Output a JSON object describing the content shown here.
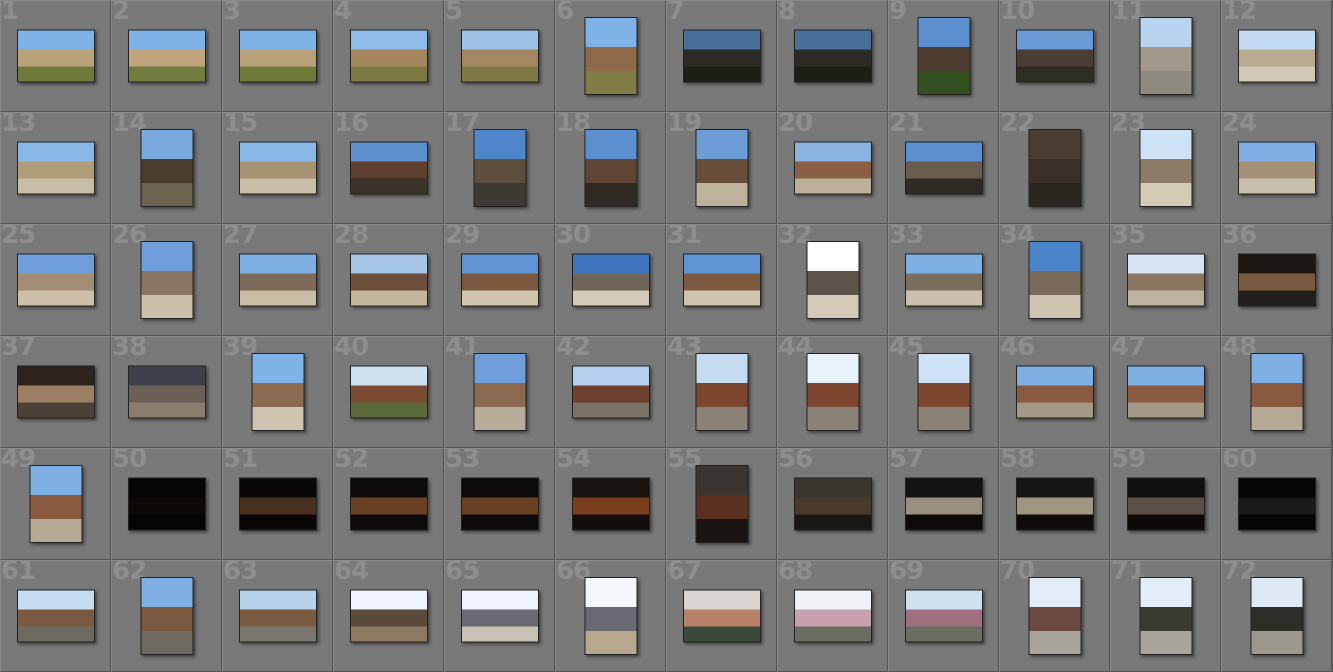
{
  "title": "",
  "grid": {
    "columns": 12,
    "rows": 6
  },
  "photos": [
    {
      "index": "1",
      "orientation": "landscape",
      "sky": "#7fb2e6",
      "mid": "#b9a27a",
      "ground": "#6e7a3a"
    },
    {
      "index": "2",
      "orientation": "landscape",
      "sky": "#7fb2e6",
      "mid": "#c0a57c",
      "ground": "#727c3e"
    },
    {
      "index": "3",
      "orientation": "landscape",
      "sky": "#7fb2e6",
      "mid": "#b9a27a",
      "ground": "#6e7a3a"
    },
    {
      "index": "4",
      "orientation": "landscape",
      "sky": "#8fbbe8",
      "mid": "#a4865c",
      "ground": "#7c7a44"
    },
    {
      "index": "5",
      "orientation": "landscape",
      "sky": "#9fc1e6",
      "mid": "#a38761",
      "ground": "#7f7a45"
    },
    {
      "index": "6",
      "orientation": "portrait",
      "sky": "#7fb2e6",
      "mid": "#8e6a4a",
      "ground": "#7f7c44"
    },
    {
      "index": "7",
      "orientation": "landscape",
      "sky": "#4a6f99",
      "mid": "#2c2a24",
      "ground": "#1b1f16"
    },
    {
      "index": "8",
      "orientation": "landscape",
      "sky": "#4a6f99",
      "mid": "#2c2a24",
      "ground": "#1b1f16"
    },
    {
      "index": "9",
      "orientation": "portrait",
      "sky": "#5b8fd0",
      "mid": "#4d3d31",
      "ground": "#355020"
    },
    {
      "index": "10",
      "orientation": "landscape",
      "sky": "#6a9bd4",
      "mid": "#4a3e34",
      "ground": "#2a2f22"
    },
    {
      "index": "11",
      "orientation": "portrait",
      "sky": "#b8d4ef",
      "mid": "#a0998c",
      "ground": "#8f8a80"
    },
    {
      "index": "12",
      "orientation": "landscape",
      "sky": "#c3dbf2",
      "mid": "#b9ab90",
      "ground": "#d1c8b5"
    },
    {
      "index": "13",
      "orientation": "landscape",
      "sky": "#89b7e6",
      "mid": "#b19c79",
      "ground": "#c7bca4"
    },
    {
      "index": "14",
      "orientation": "portrait",
      "sky": "#7aa9dd",
      "mid": "#4a3d2f",
      "ground": "#6c6250"
    },
    {
      "index": "15",
      "orientation": "landscape",
      "sky": "#89b7e6",
      "mid": "#a89275",
      "ground": "#c7bca4"
    },
    {
      "index": "16",
      "orientation": "landscape",
      "sky": "#5d8fcc",
      "mid": "#5e3e2c",
      "ground": "#3a3429"
    },
    {
      "index": "17",
      "orientation": "portrait",
      "sky": "#4f86c9",
      "mid": "#5c4d3c",
      "ground": "#3d3a33"
    },
    {
      "index": "18",
      "orientation": "portrait",
      "sky": "#5b8fd0",
      "mid": "#5f4634",
      "ground": "#2f2b24"
    },
    {
      "index": "19",
      "orientation": "portrait",
      "sky": "#6c9dd6",
      "mid": "#684d3a",
      "ground": "#bdb29c"
    },
    {
      "index": "20",
      "orientation": "landscape",
      "sky": "#8ab3df",
      "mid": "#8a5f44",
      "ground": "#bcb09b"
    },
    {
      "index": "21",
      "orientation": "landscape",
      "sky": "#5b8fd0",
      "mid": "#6a5c4d",
      "ground": "#2f2a24"
    },
    {
      "index": "22",
      "orientation": "portrait",
      "sky": "#4c3d32",
      "mid": "#3a2f26",
      "ground": "#2a2620"
    },
    {
      "index": "23",
      "orientation": "portrait",
      "sky": "#cfe2f5",
      "mid": "#8c7b66",
      "ground": "#d4cbb6"
    },
    {
      "index": "24",
      "orientation": "landscape",
      "sky": "#7eaee3",
      "mid": "#a69078",
      "ground": "#c8bfae"
    },
    {
      "index": "25",
      "orientation": "landscape",
      "sky": "#6f9fdb",
      "mid": "#a38c74",
      "ground": "#cdbfa9"
    },
    {
      "index": "26",
      "orientation": "portrait",
      "sky": "#6f9fdb",
      "mid": "#8a7662",
      "ground": "#cbbfab"
    },
    {
      "index": "27",
      "orientation": "landscape",
      "sky": "#7fb0e4",
      "mid": "#7d6a58",
      "ground": "#c9bca4"
    },
    {
      "index": "28",
      "orientation": "landscape",
      "sky": "#a7c7e8",
      "mid": "#6b4e3c",
      "ground": "#c4b69d"
    },
    {
      "index": "29",
      "orientation": "landscape",
      "sky": "#5f93d3",
      "mid": "#7a5840",
      "ground": "#d0c4ad"
    },
    {
      "index": "30",
      "orientation": "landscape",
      "sky": "#3f74bf",
      "mid": "#6f6658",
      "ground": "#d4cbba"
    },
    {
      "index": "31",
      "orientation": "landscape",
      "sky": "#5e93d4",
      "mid": "#7c5a42",
      "ground": "#cec3ad"
    },
    {
      "index": "32",
      "orientation": "portrait",
      "sky": "#ffffff",
      "mid": "#5a544a",
      "ground": "#d4cbba"
    },
    {
      "index": "33",
      "orientation": "landscape",
      "sky": "#7fb0e4",
      "mid": "#7c6e5e",
      "ground": "#cbc0ad"
    },
    {
      "index": "34",
      "orientation": "portrait",
      "sky": "#4c84c9",
      "mid": "#7a6b5a",
      "ground": "#cdc3b1"
    },
    {
      "index": "35",
      "orientation": "landscape",
      "sky": "#d6e3f0",
      "mid": "#8a7560",
      "ground": "#bcb29f"
    },
    {
      "index": "36",
      "orientation": "landscape",
      "sky": "#1c1712",
      "mid": "#7a5a3f",
      "ground": "#23201b"
    },
    {
      "index": "37",
      "orientation": "landscape",
      "sky": "#2a241d",
      "mid": "#9b7f62",
      "ground": "#4a4036"
    },
    {
      "index": "38",
      "orientation": "landscape",
      "sky": "#3d4248",
      "mid": "#6a6058",
      "ground": "#8b7d6d"
    },
    {
      "index": "39",
      "orientation": "portrait",
      "sky": "#7fb2e6",
      "mid": "#8a6a50",
      "ground": "#cdc3b1"
    },
    {
      "index": "40",
      "orientation": "landscape",
      "sky": "#cfe0f1",
      "mid": "#7a4a33",
      "ground": "#5a6a3a"
    },
    {
      "index": "41",
      "orientation": "portrait",
      "sky": "#6f9fdb",
      "mid": "#8a6a50",
      "ground": "#b8ad9a"
    },
    {
      "index": "42",
      "orientation": "landscape",
      "sky": "#b4d0ec",
      "mid": "#6e3f2c",
      "ground": "#7a7266"
    },
    {
      "index": "43",
      "orientation": "portrait",
      "sky": "#c4dbf0",
      "mid": "#7b4530",
      "ground": "#8a8276"
    },
    {
      "index": "44",
      "orientation": "portrait",
      "sky": "#e8f1fa",
      "mid": "#7b4530",
      "ground": "#8a8276"
    },
    {
      "index": "45",
      "orientation": "portrait",
      "sky": "#cfe2f5",
      "mid": "#7b4530",
      "ground": "#8a8276"
    },
    {
      "index": "46",
      "orientation": "landscape",
      "sky": "#7fb0e4",
      "mid": "#8a5a40",
      "ground": "#a49886"
    },
    {
      "index": "47",
      "orientation": "landscape",
      "sky": "#7fb0e4",
      "mid": "#8a5a40",
      "ground": "#a49886"
    },
    {
      "index": "48",
      "orientation": "portrait",
      "sky": "#7fb0e4",
      "mid": "#8a5a40",
      "ground": "#b6aa96"
    },
    {
      "index": "49",
      "orientation": "portrait",
      "sky": "#7fb0e4",
      "mid": "#8a5a40",
      "ground": "#b6aa96"
    },
    {
      "index": "50",
      "orientation": "landscape",
      "sky": "#060504",
      "mid": "#0c0907",
      "ground": "#050403"
    },
    {
      "index": "51",
      "orientation": "landscape",
      "sky": "#0a0807",
      "mid": "#4a3020",
      "ground": "#0a0807"
    },
    {
      "index": "52",
      "orientation": "landscape",
      "sky": "#0d0b09",
      "mid": "#6a4024",
      "ground": "#0d0b09"
    },
    {
      "index": "53",
      "orientation": "landscape",
      "sky": "#0d0b09",
      "mid": "#6a4024",
      "ground": "#0d0b09"
    },
    {
      "index": "54",
      "orientation": "landscape",
      "sky": "#1a1410",
      "mid": "#7a3c1c",
      "ground": "#120e0b"
    },
    {
      "index": "55",
      "orientation": "portrait",
      "sky": "#3a3530",
      "mid": "#5a3020",
      "ground": "#1a1512"
    },
    {
      "index": "56",
      "orientation": "landscape",
      "sky": "#3a3630",
      "mid": "#4a3a2c",
      "ground": "#1a1612"
    },
    {
      "index": "57",
      "orientation": "landscape",
      "sky": "#151311",
      "mid": "#9a9080",
      "ground": "#0c0b0a"
    },
    {
      "index": "58",
      "orientation": "landscape",
      "sky": "#171513",
      "mid": "#a09684",
      "ground": "#0d0c0b"
    },
    {
      "index": "59",
      "orientation": "landscape",
      "sky": "#111",
      "mid": "#5a5048",
      "ground": "#0b0a09"
    },
    {
      "index": "60",
      "orientation": "landscape",
      "sky": "#050505",
      "mid": "#1a1a1a",
      "ground": "#050505"
    },
    {
      "index": "61",
      "orientation": "landscape",
      "sky": "#c7dcf0",
      "mid": "#7a5a40",
      "ground": "#6e6a62"
    },
    {
      "index": "62",
      "orientation": "portrait",
      "sky": "#7fb0e4",
      "mid": "#7a5a40",
      "ground": "#6e6a62"
    },
    {
      "index": "63",
      "orientation": "landscape",
      "sky": "#b9d2ec",
      "mid": "#7a5a40",
      "ground": "#7a766e"
    },
    {
      "index": "64",
      "orientation": "landscape",
      "sky": "#eef4fa",
      "mid": "#5a4a3c",
      "ground": "#8e7a62"
    },
    {
      "index": "65",
      "orientation": "landscape",
      "sky": "#eef4fa",
      "mid": "#6a6a72",
      "ground": "#c8c2b6"
    },
    {
      "index": "66",
      "orientation": "portrait",
      "sky": "#f4f8fc",
      "mid": "#6a6a72",
      "ground": "#b9a890"
    },
    {
      "index": "67",
      "orientation": "landscape",
      "sky": "#d9d4cf",
      "mid": "#b8826a",
      "ground": "#3a4a3a"
    },
    {
      "index": "68",
      "orientation": "landscape",
      "sky": "#eef2f6",
      "mid": "#c8a0b0",
      "ground": "#6a6e60"
    },
    {
      "index": "69",
      "orientation": "landscape",
      "sky": "#cfe0f1",
      "mid": "#a07080",
      "ground": "#6a6e60"
    },
    {
      "index": "70",
      "orientation": "portrait",
      "sky": "#e3edf7",
      "mid": "#6a4a40",
      "ground": "#a8a49c"
    },
    {
      "index": "71",
      "orientation": "portrait",
      "sky": "#e3edf7",
      "mid": "#3a3a32",
      "ground": "#a8a49c"
    },
    {
      "index": "72",
      "orientation": "portrait",
      "sky": "#dfe9f4",
      "mid": "#2e2e28",
      "ground": "#9c988e"
    }
  ]
}
